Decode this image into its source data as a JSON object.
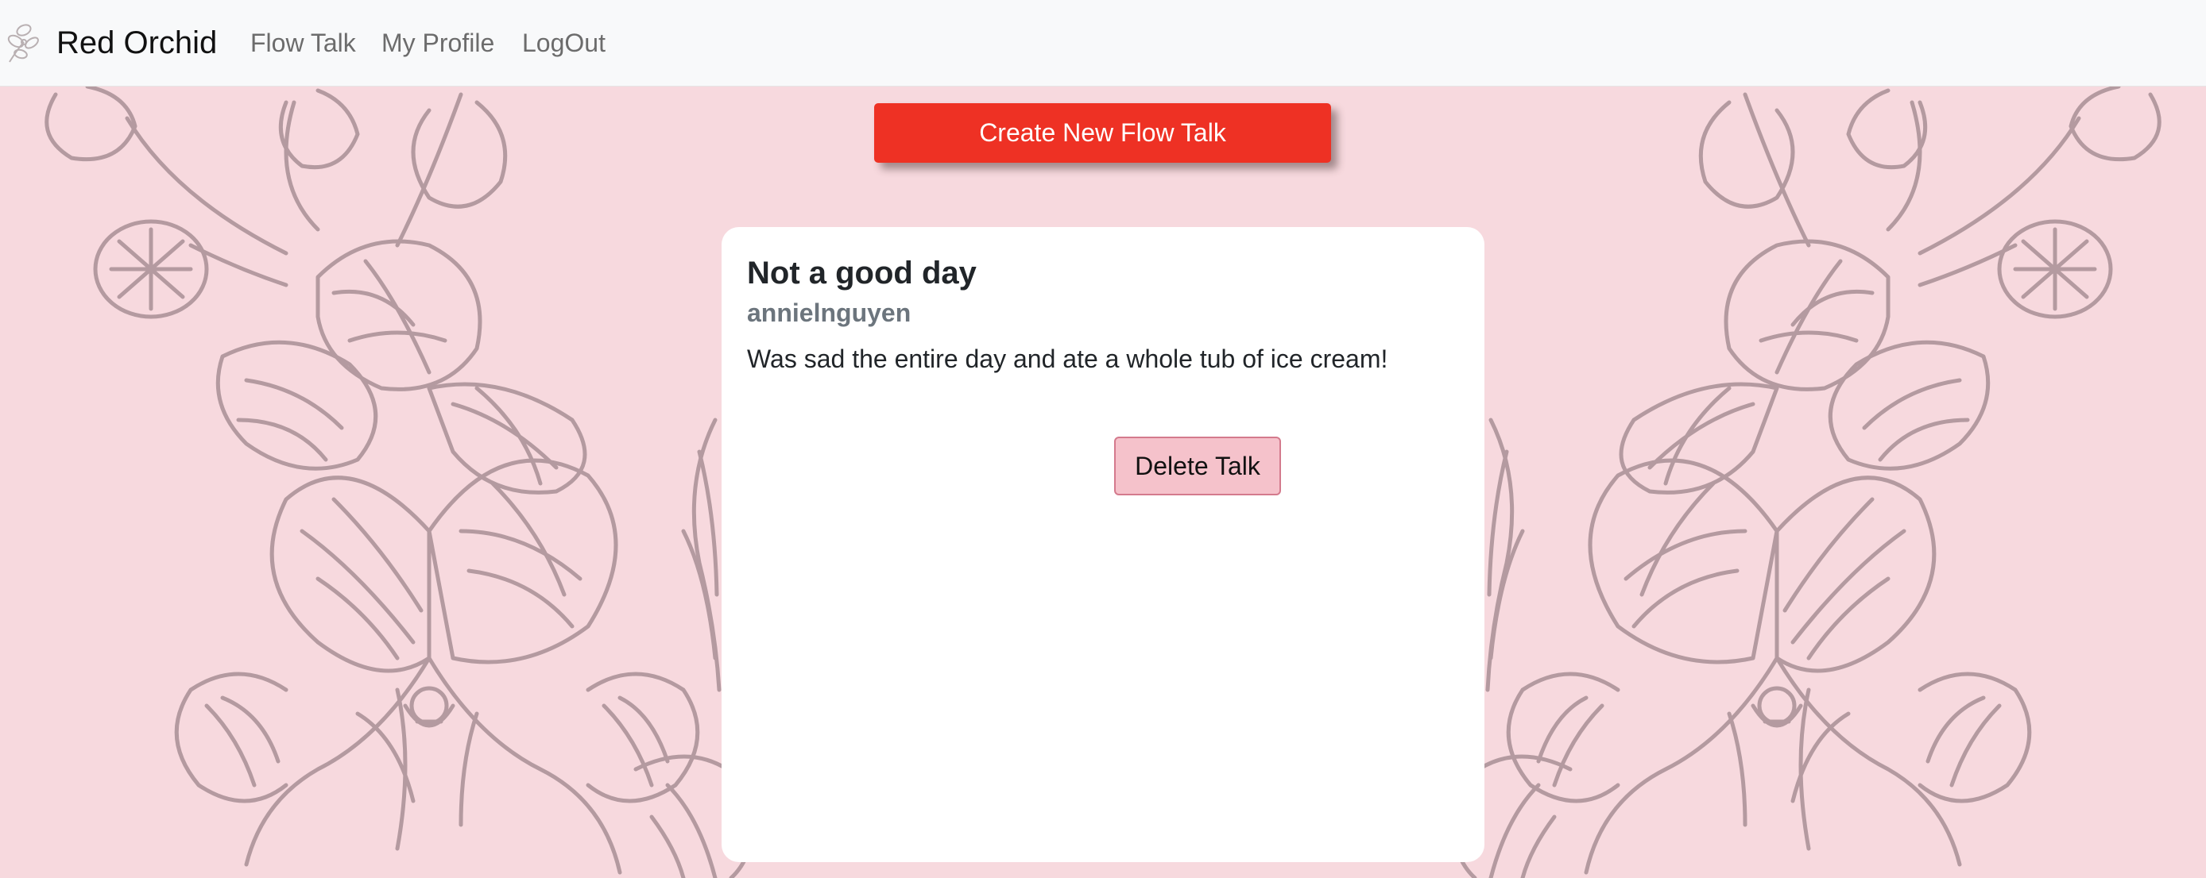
{
  "navbar": {
    "brand_name": "Red Orchid",
    "links": [
      {
        "label": "Flow Talk"
      },
      {
        "label": "My Profile"
      },
      {
        "label": "LogOut"
      }
    ]
  },
  "main": {
    "create_button_label": "Create New Flow Talk",
    "talk": {
      "title": "Not a good day",
      "author": "annielnguyen",
      "body": "Was sad the entire day and ate a whole tub of ice cream!",
      "delete_button_label": "Delete Talk"
    }
  },
  "colors": {
    "background": "#f7d9de",
    "line_art": "#b49aa0",
    "create_button": "#ee3124",
    "delete_button": "#f5c2cb",
    "navbar": "#f8f9fa"
  },
  "icons": {
    "brand_logo": "orchid-logo-icon"
  }
}
